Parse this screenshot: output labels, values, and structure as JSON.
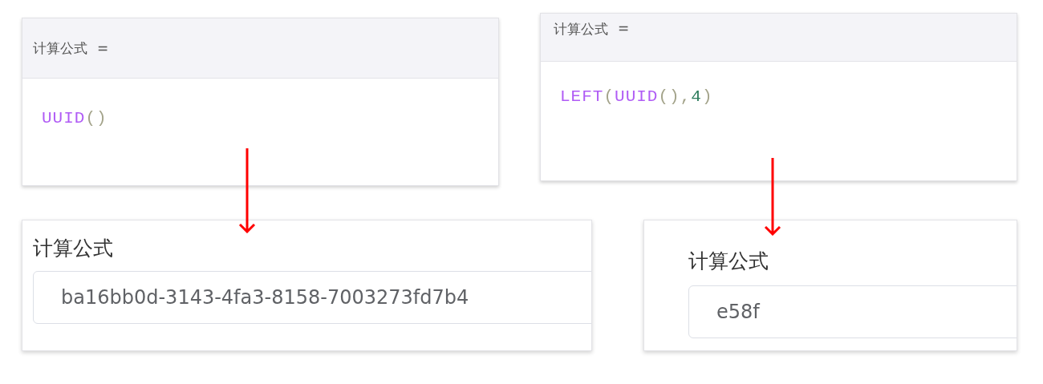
{
  "examples": [
    {
      "editor": {
        "label": "计算公式",
        "operator": "=",
        "tokens": [
          {
            "kind": "function",
            "text": "UUID"
          },
          {
            "kind": "paren",
            "text": "()"
          }
        ]
      },
      "result": {
        "label": "计算公式",
        "value": "ba16bb0d-3143-4fa3-8158-7003273fd7b4"
      }
    },
    {
      "editor": {
        "label": "计算公式",
        "operator": "=",
        "tokens": [
          {
            "kind": "function",
            "text": "LEFT"
          },
          {
            "kind": "paren",
            "text": "("
          },
          {
            "kind": "function",
            "text": "UUID"
          },
          {
            "kind": "paren",
            "text": "(),"
          },
          {
            "kind": "number",
            "text": "4"
          },
          {
            "kind": "paren",
            "text": ")"
          }
        ]
      },
      "result": {
        "label": "计算公式",
        "value": "e58f"
      }
    }
  ]
}
